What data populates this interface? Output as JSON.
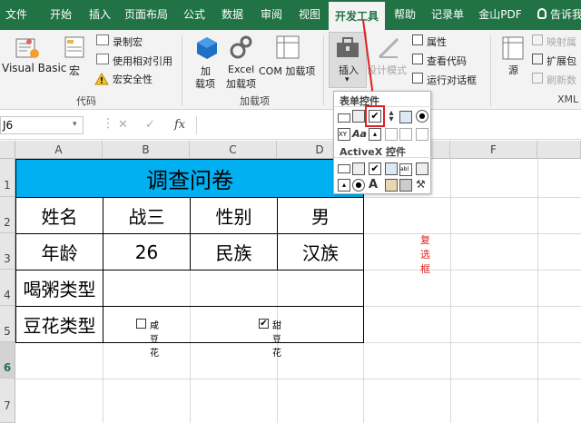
{
  "tabs": [
    {
      "label": "文件",
      "key": "file"
    },
    {
      "label": "开始",
      "key": "home"
    },
    {
      "label": "插入",
      "key": "insert"
    },
    {
      "label": "页面布局",
      "key": "page-layout"
    },
    {
      "label": "公式",
      "key": "formulas"
    },
    {
      "label": "数据",
      "key": "data"
    },
    {
      "label": "审阅",
      "key": "review"
    },
    {
      "label": "视图",
      "key": "view"
    },
    {
      "label": "开发工具",
      "key": "developer"
    },
    {
      "label": "帮助",
      "key": "help"
    },
    {
      "label": "记录单",
      "key": "record"
    },
    {
      "label": "金山PDF",
      "key": "wps-pdf"
    }
  ],
  "tell_me_label": "告诉我",
  "ribbon": {
    "code": {
      "visual_basic": "Visual Basic",
      "macros": "宏",
      "record_macro": "录制宏",
      "relative_ref": "使用相对引用",
      "macro_security": "宏安全性",
      "label": "代码"
    },
    "addins": {
      "addins": "加",
      "addins2": "载项",
      "excel_addins": "Excel",
      "excel_addins2": "加载项",
      "com_addins": "COM 加载项",
      "label": "加载项"
    },
    "controls": {
      "insert": "插入",
      "design_mode": "设计模式",
      "properties": "属性",
      "view_code": "查看代码",
      "run_dialog": "运行对话框"
    },
    "xml": {
      "source": "源",
      "map_props": "映射属",
      "expand": "扩展包",
      "refresh": "刷新数",
      "label": "XML"
    }
  },
  "namebox_value": "J6",
  "formula_icons": {
    "cancel": "✕",
    "enter": "✓",
    "fx": "fx"
  },
  "columns": [
    "A",
    "B",
    "C",
    "D",
    "E",
    "F"
  ],
  "rows": [
    "1",
    "2",
    "3",
    "4",
    "5",
    "6",
    "7"
  ],
  "sheet": {
    "title": "调查问卷",
    "name_label": "姓名",
    "name_value": "战三",
    "gender_label": "性别",
    "gender_value": "男",
    "age_label": "年龄",
    "age_value": "26",
    "ethnicity_label": "民族",
    "ethnicity_value": "汉族",
    "porridge_label": "喝粥类型",
    "tofu_label": "豆花类型",
    "checkbox_salty": "咸豆花",
    "checkbox_sweet": "甜豆花"
  },
  "checkbox_states": {
    "salty": false,
    "sweet": true
  },
  "annotation": "复选框",
  "popup": {
    "form_controls_title": "表单控件",
    "activex_title": "ActiveX 控件"
  },
  "colors": {
    "accent": "#217346",
    "title_fill": "#00b0f0",
    "highlight_red": "#e02020"
  }
}
